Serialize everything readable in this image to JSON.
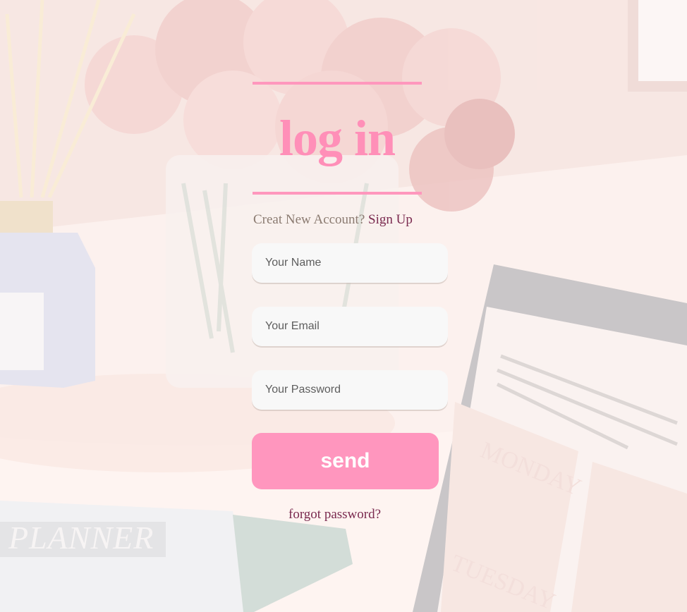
{
  "login": {
    "title": "log in",
    "signup_prompt": "Creat New Account?",
    "signup_link": "Sign Up",
    "name_placeholder": "Your Name",
    "email_placeholder": "Your Email",
    "password_placeholder": "Your Password",
    "send_label": "send",
    "forgot_label": "forgot password?"
  },
  "background": {
    "planner_text": "PLANNER",
    "day_1": "MONDAY",
    "day_2": "TUESDAY"
  },
  "colors": {
    "accent_pink": "#ff96be",
    "link": "#7a2a4f",
    "muted_text": "#8b7b71",
    "field_bg": "#f8f8f8"
  }
}
